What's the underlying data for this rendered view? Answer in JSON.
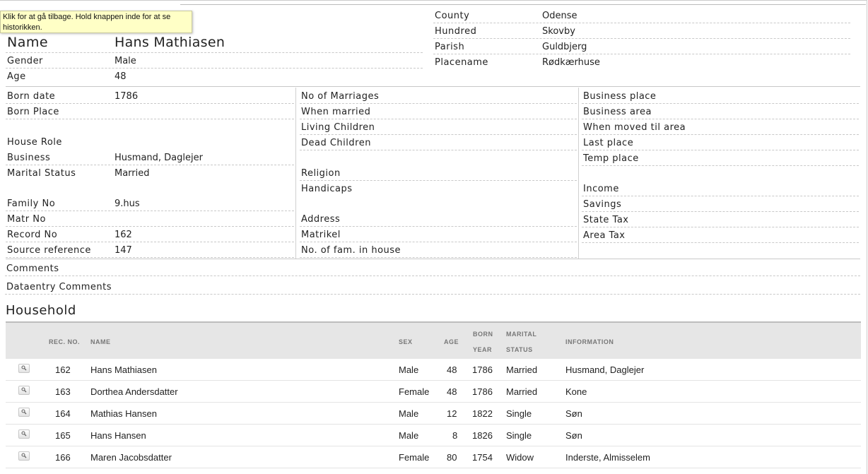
{
  "tooltip": "Klik for at gå tilbage. Hold knappen inde for at se historikken.",
  "person": {
    "name_label": "Name",
    "name": "Hans Mathiasen",
    "gender_label": "Gender",
    "gender": "Male",
    "age_label": "Age",
    "age": "48"
  },
  "location": {
    "county_label": "County",
    "county": "Odense",
    "hundred_label": "Hundred",
    "hundred": "Skovby",
    "parish_label": "Parish",
    "parish": "Guldbjerg",
    "placename_label": "Placename",
    "placename": "Rødkærhuse"
  },
  "col1": [
    {
      "label": "Born date",
      "value": "1786"
    },
    {
      "label": "Born Place",
      "value": ""
    },
    {
      "label": "House Role",
      "value": ""
    },
    {
      "label": "Business",
      "value": "Husmand, Daglejer"
    },
    {
      "label": "Marital Status",
      "value": "Married"
    },
    {
      "label": "Family No",
      "value": "9.hus"
    },
    {
      "label": "Matr No",
      "value": ""
    },
    {
      "label": "Record No",
      "value": "162"
    },
    {
      "label": "Source reference",
      "value": "147"
    }
  ],
  "col2": [
    {
      "label": "No of Marriages"
    },
    {
      "label": "When married"
    },
    {
      "label": "Living Children"
    },
    {
      "label": "Dead Children"
    },
    {
      "label": "Religion"
    },
    {
      "label": "Handicaps"
    },
    {
      "label": "Address"
    },
    {
      "label": "Matrikel"
    },
    {
      "label": "No. of fam. in house"
    }
  ],
  "col3": [
    {
      "label": "Business place"
    },
    {
      "label": "Business area"
    },
    {
      "label": "When moved til area"
    },
    {
      "label": "Last place"
    },
    {
      "label": "Temp place"
    },
    {
      "label": "Income"
    },
    {
      "label": "Savings"
    },
    {
      "label": "State Tax"
    },
    {
      "label": "Area Tax"
    }
  ],
  "comments_label": "Comments",
  "dataentry_label": "Dataentry Comments",
  "household": {
    "title": "Household",
    "headers": {
      "rec": "REC. NO.",
      "name": "NAME",
      "sex": "SEX",
      "age": "AGE",
      "born1": "BORN",
      "born2": "YEAR",
      "marital1": "MARITAL",
      "marital2": "STATUS",
      "info": "INFORMATION"
    },
    "rows": [
      {
        "rec": "162",
        "name": "Hans Mathiasen",
        "sex": "Male",
        "age": "48",
        "born": "1786",
        "marital": "Married",
        "info": "Husmand, Daglejer"
      },
      {
        "rec": "163",
        "name": "Dorthea Andersdatter",
        "sex": "Female",
        "age": "48",
        "born": "1786",
        "marital": "Married",
        "info": "Kone"
      },
      {
        "rec": "164",
        "name": "Mathias Hansen",
        "sex": "Male",
        "age": "12",
        "born": "1822",
        "marital": "Single",
        "info": "Søn"
      },
      {
        "rec": "165",
        "name": "Hans Hansen",
        "sex": "Male",
        "age": "8",
        "born": "1826",
        "marital": "Single",
        "info": "Søn"
      },
      {
        "rec": "166",
        "name": "Maren Jacobsdatter",
        "sex": "Female",
        "age": "80",
        "born": "1754",
        "marital": "Widow",
        "info": "Inderste, Almisselem"
      }
    ]
  },
  "icons": {
    "view_record": "magnifier-icon"
  }
}
